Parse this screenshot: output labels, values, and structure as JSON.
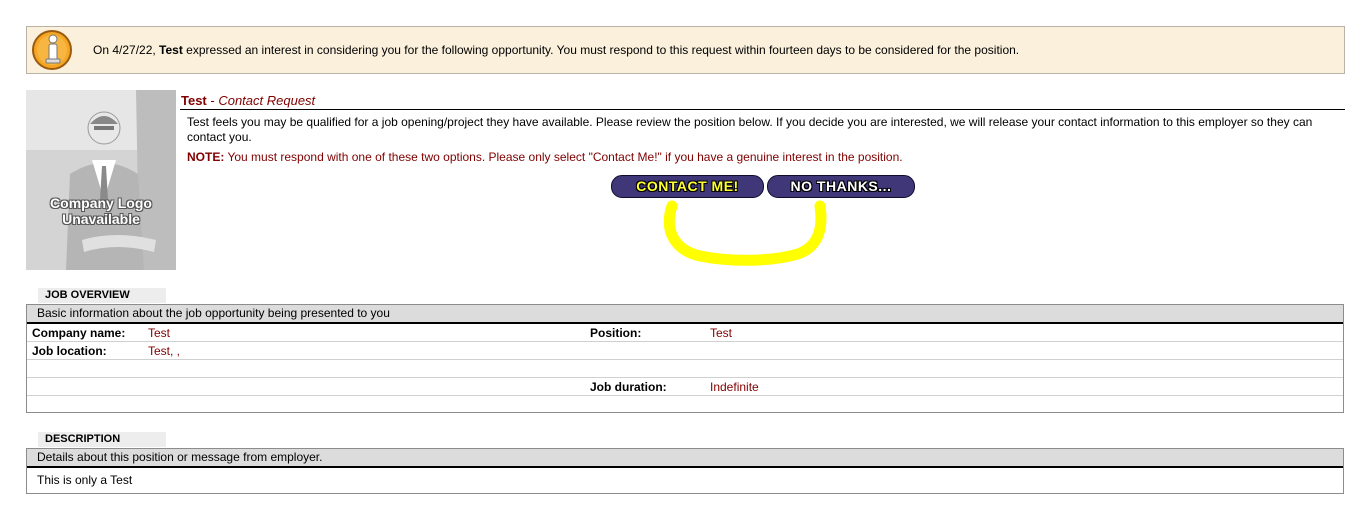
{
  "notice": {
    "prefix": "On 4/27/22, ",
    "employer": "Test",
    "suffix": " expressed an interest in considering you for the following opportunity. You must respond to this request within fourteen days to be considered for the position."
  },
  "logo": {
    "line1": "Company Logo",
    "line2": "Unavailable"
  },
  "request": {
    "employer": "Test",
    "separator": " - ",
    "subtitle": "Contact Request",
    "body": "Test feels you may be qualified for a job opening/project they have available. Please review the position below. If you decide you are interested, we will release your contact information to this employer so they can contact you.",
    "note_label": "NOTE:",
    "note_text": " You must respond with one of these two options. Please only select \"Contact Me!\" if you have a genuine interest in the position.",
    "contact_label": "CONTACT ME!",
    "decline_label": "NO THANKS..."
  },
  "job_overview": {
    "tab": "JOB OVERVIEW",
    "header": "Basic information about the job opportunity being presented to you",
    "company_label": "Company name:",
    "company_value": "Test",
    "position_label": "Position:",
    "position_value": "Test",
    "location_label": "Job location:",
    "location_value": "Test, ,",
    "duration_label": "Job duration:",
    "duration_value": "Indefinite"
  },
  "description": {
    "tab": "DESCRIPTION",
    "header": "Details about this position or message from employer.",
    "body": "This is only a Test"
  },
  "colors": {
    "notice_bg": "#faf0dc",
    "accent_dark_red": "#800000",
    "button_bg": "#3f3777",
    "contact_text": "#ffff33",
    "annotation_yellow": "#ffff00"
  }
}
